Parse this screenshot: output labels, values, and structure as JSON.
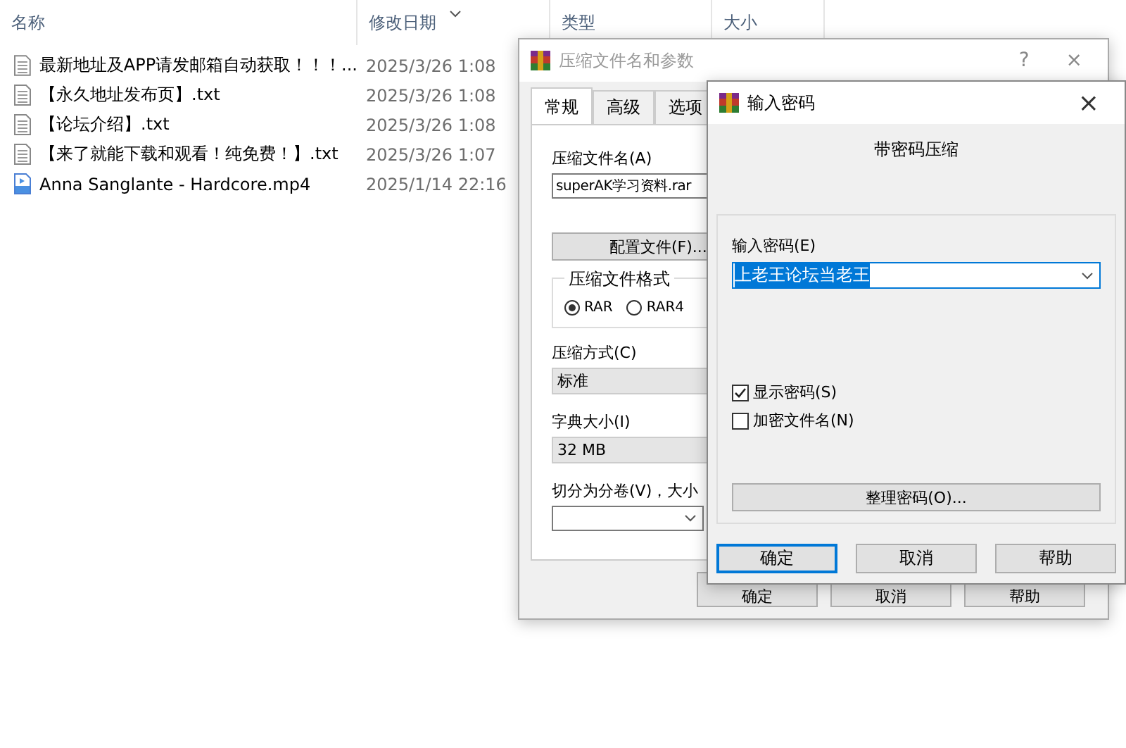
{
  "explorer": {
    "columns": [
      "名称",
      "修改日期",
      "类型",
      "大小"
    ],
    "files": [
      {
        "name": "最新地址及APP请发邮箱自动获取！！！...",
        "modified": "2025/3/26 1:08",
        "kind": "text"
      },
      {
        "name": "【永久地址发布页】.txt",
        "modified": "2025/3/26 1:08",
        "kind": "text"
      },
      {
        "name": "【论坛介绍】.txt",
        "modified": "2025/3/26 1:08",
        "kind": "text"
      },
      {
        "name": "【来了就能下载和观看！纯免费！】.txt",
        "modified": "2025/3/26 1:07",
        "kind": "text"
      },
      {
        "name": "Anna Sanglante - Hardcore.mp4",
        "modified": "2025/1/14 22:16",
        "kind": "video"
      }
    ]
  },
  "archive_dialog": {
    "title": "压缩文件名和参数",
    "help": "?",
    "close": "×",
    "tabs": [
      {
        "label": "常规",
        "selected": true
      },
      {
        "label": "高级",
        "selected": false
      },
      {
        "label": "选项",
        "selected": false
      }
    ],
    "archive_name_label": "压缩文件名(A)",
    "archive_name": "superAK学习资料.rar",
    "profiles_button": "配置文件(F)...",
    "format_group": {
      "title": "压缩文件格式",
      "options": [
        {
          "label": "RAR",
          "selected": true
        },
        {
          "label": "RAR4",
          "selected": false
        }
      ]
    },
    "method_label": "压缩方式(C)",
    "method": "标准",
    "dictionary_label": "字典大小(I)",
    "dictionary": "32 MB",
    "split_label": "切分为分卷(V)，大小",
    "buttons": [
      "确定",
      "取消",
      "帮助"
    ]
  },
  "password_dialog": {
    "title": "输入密码",
    "close": "×",
    "heading": "带密码压缩",
    "password_label": "输入密码(E)",
    "password": {
      "value": "上老王论坛当老王",
      "selected": true
    },
    "checkboxes": [
      {
        "label": "显示密码(S)",
        "checked": true
      },
      {
        "label": "加密文件名(N)",
        "checked": false
      }
    ],
    "organize_button": "整理密码(O)...",
    "buttons": [
      {
        "label": "确定",
        "default": true
      },
      {
        "label": "取消",
        "default": false
      },
      {
        "label": "帮助",
        "default": false
      }
    ]
  }
}
